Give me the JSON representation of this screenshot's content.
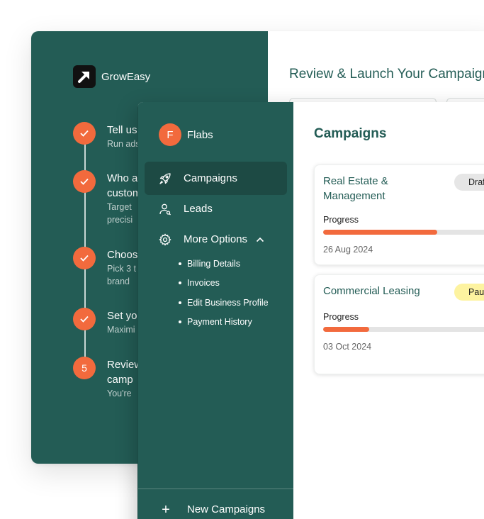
{
  "brand": {
    "name": "GrowEasy"
  },
  "wizard": {
    "title": "Review & Launch Your Campaign",
    "steps": [
      {
        "marker": "✓",
        "title": "Tell us",
        "sub": "Run ads"
      },
      {
        "marker": "✓",
        "title": "Who a\ncustom",
        "sub": "Target\nprecisi"
      },
      {
        "marker": "✓",
        "title": "Choos",
        "sub": "Pick 3 t\nbrand"
      },
      {
        "marker": "✓",
        "title": "Set yo",
        "sub": "Maximi"
      },
      {
        "marker": "5",
        "title": "Review\ncamp",
        "sub": "You're"
      }
    ]
  },
  "user": {
    "initial": "F",
    "name": "Flabs"
  },
  "nav": {
    "campaigns": "Campaigns",
    "leads": "Leads",
    "more_options": "More Options",
    "sub_items": [
      "Billing Details",
      "Invoices",
      "Edit Business Profile",
      "Payment History"
    ],
    "new_campaigns": "New Campaigns",
    "plus": "+"
  },
  "main": {
    "title": "Campaigns",
    "cards": [
      {
        "title": "Real Estate &\nManagement",
        "status": "Draft",
        "progress_label": "Progress",
        "progress": 0.62,
        "date": "26 Aug 2024"
      },
      {
        "title": "Commercial Leasing",
        "status": "Paused",
        "progress_label": "Progress",
        "progress": 0.25,
        "date": "03 Oct 2024"
      }
    ]
  },
  "colors": {
    "sidebar": "#235c55",
    "accent": "#f26a3d",
    "draft_badge": "#e6e6e6",
    "paused_badge": "#fdf3a0"
  },
  "icons": {
    "brand_logo": "arrow-up-right-icon",
    "step_done": "checkmark-icon",
    "campaigns": "rocket-icon",
    "leads": "user-icon",
    "more_options": "gear-icon",
    "collapse": "chevron-up-icon",
    "new_campaigns": "plus-icon"
  }
}
